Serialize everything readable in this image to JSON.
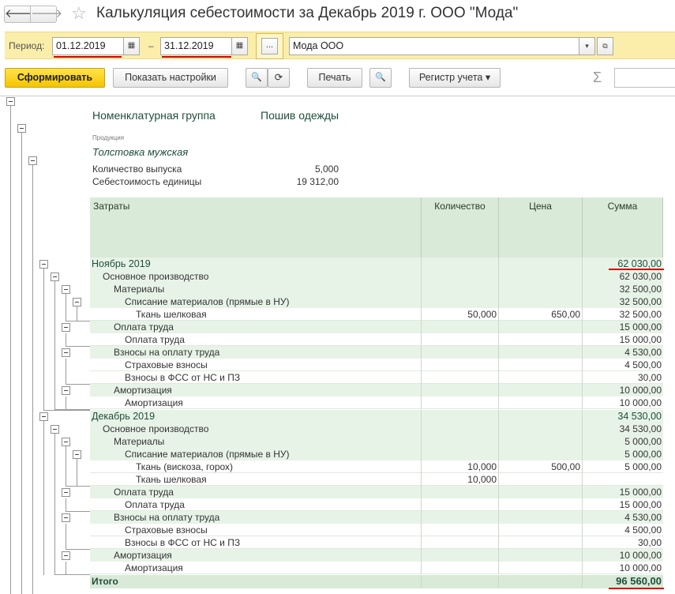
{
  "window": {
    "title": "Калькуляция себестоимости за Декабрь 2019 г. ООО \"Мода\"",
    "back_glyph": "🡐",
    "forward_glyph": "🡒",
    "star_glyph": "☆"
  },
  "period": {
    "label": "Период:",
    "date_from": "01.12.2019",
    "dash": "–",
    "date_to": "31.12.2019",
    "calendar_glyph": "▦",
    "dots_label": "...",
    "organization": "Мода ООО",
    "dropdown_glyph": "▾",
    "open_glyph": "⧉"
  },
  "toolbar": {
    "generate": "Сформировать",
    "show_settings": "Показать настройки",
    "search_glyph": "🔍",
    "search_next_glyph": "⟳",
    "print": "Печать",
    "preview_glyph": "🔍",
    "register": "Регистр учета",
    "register_arrow": "▾",
    "sigma": "Σ"
  },
  "report": {
    "group_label": "Номенклатурная группа",
    "group_value": "Пошив одежды",
    "product_label": "Продукция",
    "product_value": "Толстовка мужская",
    "output_qty_label": "Количество выпуска",
    "output_qty_value": "5,000",
    "unit_cost_label": "Себестоимость единицы",
    "unit_cost_value": "19 312,00",
    "columns": {
      "costs": "Затраты",
      "quantity": "Количество",
      "price": "Цена",
      "sum": "Сумма"
    },
    "rows": [
      {
        "label": "Ноябрь 2019",
        "qty": "",
        "price": "",
        "sum": "62 030,00"
      },
      {
        "label": "Основное производство",
        "qty": "",
        "price": "",
        "sum": "62 030,00"
      },
      {
        "label": "Материалы",
        "qty": "",
        "price": "",
        "sum": "32 500,00"
      },
      {
        "label": "Списание материалов (прямые в НУ)",
        "qty": "",
        "price": "",
        "sum": "32 500,00"
      },
      {
        "label": "Ткань шелковая",
        "qty": "50,000",
        "price": "650,00",
        "sum": "32 500,00"
      },
      {
        "label": "Оплата труда",
        "qty": "",
        "price": "",
        "sum": "15 000,00"
      },
      {
        "label": "Оплата труда",
        "qty": "",
        "price": "",
        "sum": "15 000,00"
      },
      {
        "label": "Взносы на оплату труда",
        "qty": "",
        "price": "",
        "sum": "4 530,00"
      },
      {
        "label": "Страховые взносы",
        "qty": "",
        "price": "",
        "sum": "4 500,00"
      },
      {
        "label": "Взносы в ФСС от НС и ПЗ",
        "qty": "",
        "price": "",
        "sum": "30,00"
      },
      {
        "label": "Амортизация",
        "qty": "",
        "price": "",
        "sum": "10 000,00"
      },
      {
        "label": "Амортизация",
        "qty": "",
        "price": "",
        "sum": "10 000,00"
      },
      {
        "label": "Декабрь 2019",
        "qty": "",
        "price": "",
        "sum": "34 530,00"
      },
      {
        "label": "Основное производство",
        "qty": "",
        "price": "",
        "sum": "34 530,00"
      },
      {
        "label": "Материалы",
        "qty": "",
        "price": "",
        "sum": "5 000,00"
      },
      {
        "label": "Списание материалов (прямые в НУ)",
        "qty": "",
        "price": "",
        "sum": "5 000,00"
      },
      {
        "label": "Ткань (вискоза, горох)",
        "qty": "10,000",
        "price": "500,00",
        "sum": "5 000,00"
      },
      {
        "label": "Ткань шелковая",
        "qty": "10,000",
        "price": "",
        "sum": ""
      },
      {
        "label": "Оплата труда",
        "qty": "",
        "price": "",
        "sum": "15 000,00"
      },
      {
        "label": "Оплата труда",
        "qty": "",
        "price": "",
        "sum": "15 000,00"
      },
      {
        "label": "Взносы на оплату труда",
        "qty": "",
        "price": "",
        "sum": "4 530,00"
      },
      {
        "label": "Страховые взносы",
        "qty": "",
        "price": "",
        "sum": "4 500,00"
      },
      {
        "label": "Взносы в ФСС от НС и ПЗ",
        "qty": "",
        "price": "",
        "sum": "30,00"
      },
      {
        "label": "Амортизация",
        "qty": "",
        "price": "",
        "sum": "10 000,00"
      },
      {
        "label": "Амортизация",
        "qty": "",
        "price": "",
        "sum": "10 000,00"
      }
    ],
    "total": {
      "label": "Итого",
      "sum": "96 560,00"
    }
  }
}
